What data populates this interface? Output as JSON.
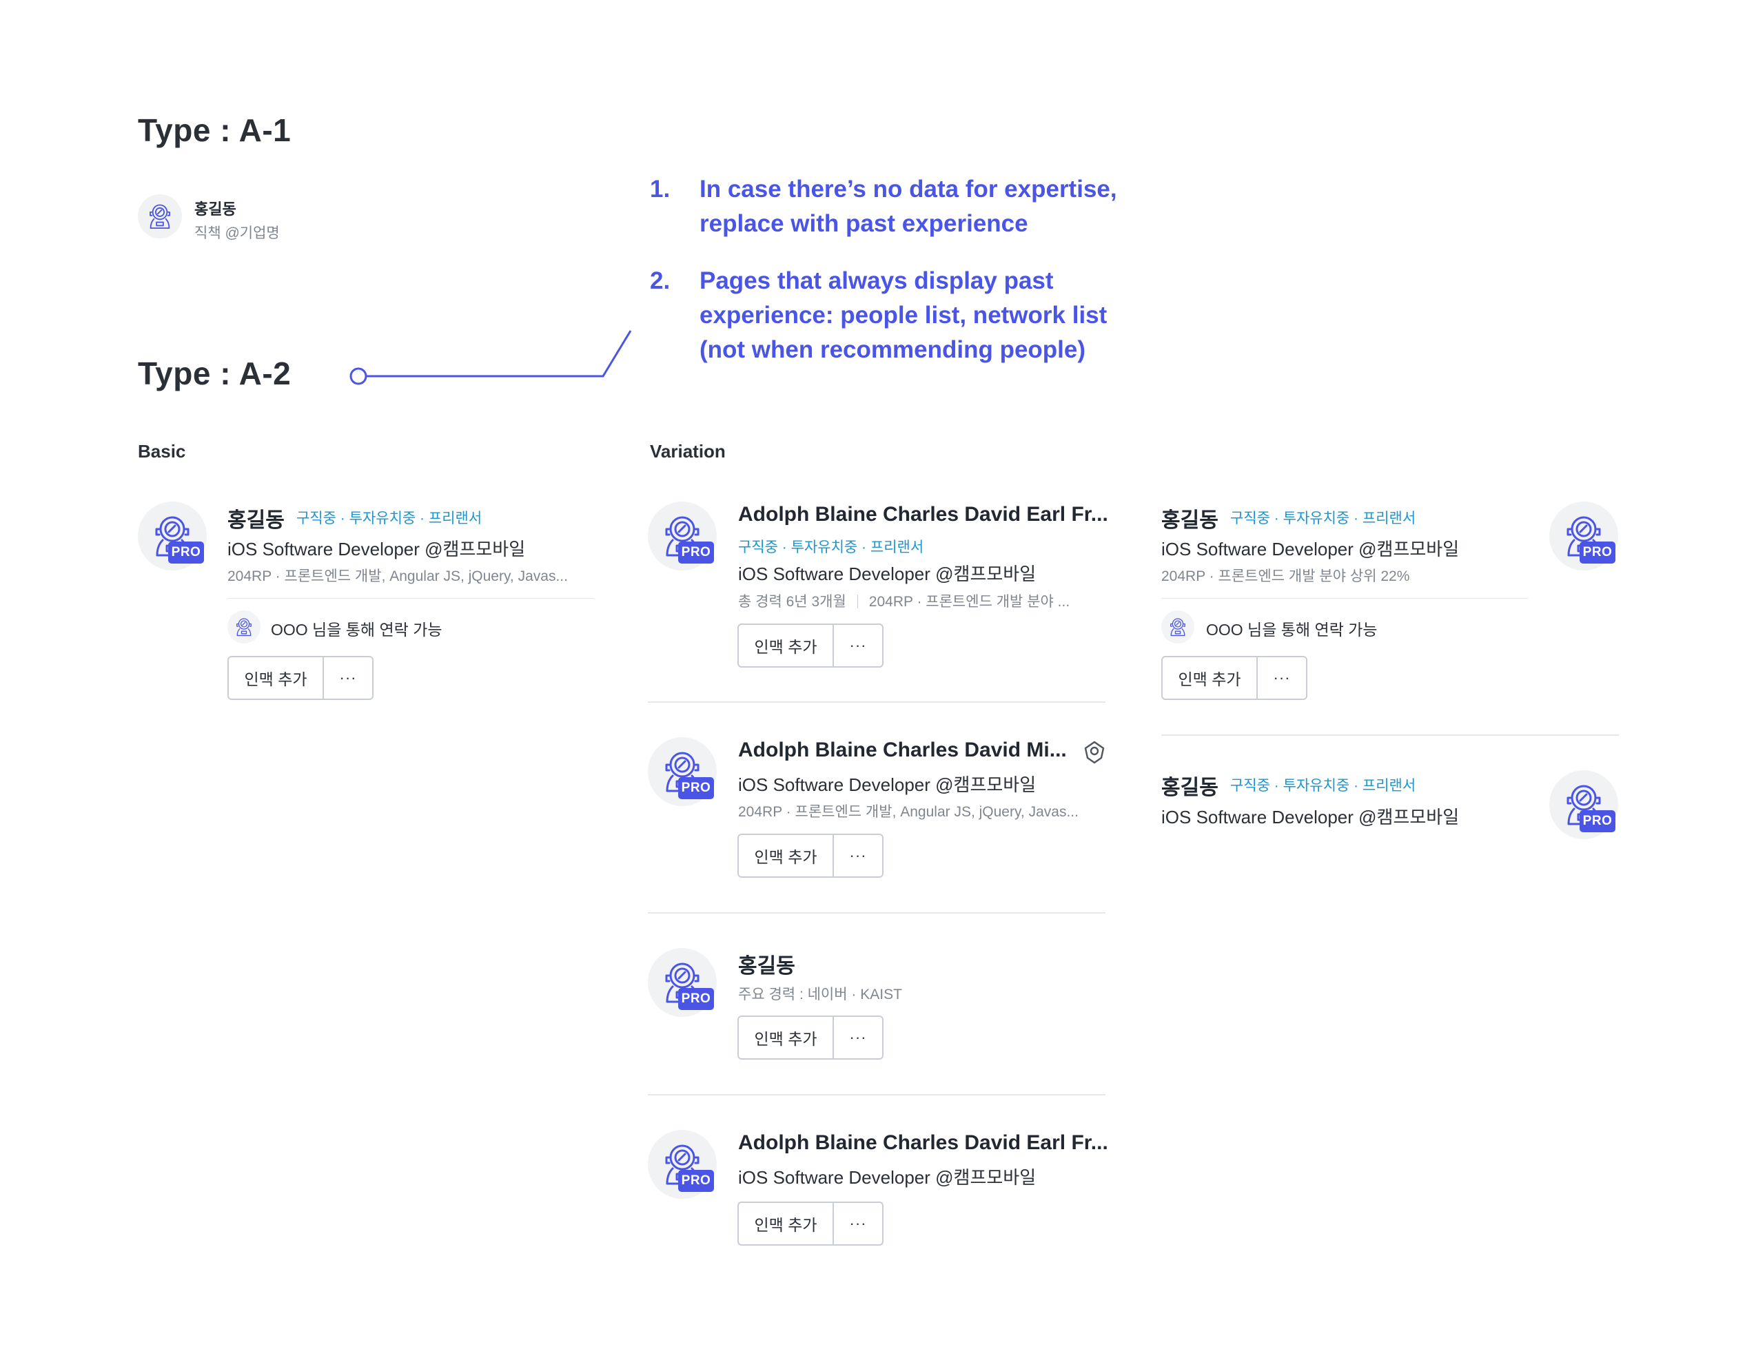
{
  "type_a1": {
    "title": "Type : A-1",
    "name": "홍길동",
    "subtitle": "직책 @기업명"
  },
  "type_a2": {
    "title": "Type : A-2"
  },
  "notes": [
    {
      "num": "1.",
      "text": "In case there’s no data for expertise, replace with past experience"
    },
    {
      "num": "2.",
      "text": "Pages that always display past experience: people list, network list (not when recommending people)"
    }
  ],
  "basic": {
    "label": "Basic",
    "card": {
      "name": "홍길동",
      "badges": "구직중 · 투자유치중 · 프리랜서",
      "role": "iOS Software Developer @캠프모바일",
      "meta": "204RP · 프론트엔드 개발, Angular JS, jQuery, Javas...",
      "contact": "OOO 님을 통해 연락 가능",
      "pro": "PRO",
      "add_button": "인맥 추가",
      "more_button": "···"
    }
  },
  "variation": {
    "label": "Variation",
    "cards": [
      {
        "name": "Adolph Blaine Charles David Earl Fr...",
        "badges": "구직중 · 투자유치중 · 프리랜서",
        "role": "iOS Software Developer @캠프모바일",
        "meta_a": "총 경력 6년 3개월",
        "meta_b": "204RP · 프론트엔드 개발 분야 ...",
        "pro": "PRO",
        "add_button": "인맥 추가",
        "more_button": "···"
      },
      {
        "name": "Adolph Blaine Charles David Mi...",
        "role": "iOS Software Developer @캠프모바일",
        "meta": "204RP · 프론트엔드 개발, Angular JS, jQuery, Javas...",
        "pro": "PRO",
        "add_button": "인맥 추가",
        "more_button": "···"
      },
      {
        "name": "홍길동",
        "meta": "주요 경력 : 네이버 · KAIST",
        "pro": "PRO",
        "add_button": "인맥 추가",
        "more_button": "···"
      },
      {
        "name": "Adolph Blaine Charles David Earl Fr...",
        "role": "iOS Software Developer @캠프모바일",
        "pro": "PRO",
        "add_button": "인맥 추가",
        "more_button": "···"
      }
    ],
    "right_cards": [
      {
        "name": "홍길동",
        "badges": "구직중 · 투자유치중 · 프리랜서",
        "role": "iOS Software Developer @캠프모바일",
        "meta": "204RP · 프론트엔드 개발 분야 상위 22%",
        "contact": "OOO 님을 통해 연락 가능",
        "pro": "PRO",
        "add_button": "인맥 추가",
        "more_button": "···"
      },
      {
        "name": "홍길동",
        "badges": "구직중 · 투자유치중 · 프리랜서",
        "role": "iOS Software Developer @캠프모바일",
        "pro": "PRO"
      }
    ]
  },
  "colors": {
    "accent": "#4a55e6",
    "badge_text": "#1a96d0",
    "pro_badge": "#4a55e6",
    "muted_text": "#80868f",
    "heading": "#2b2f36"
  },
  "icons": {
    "avatar": "astronaut-avatar-icon",
    "verified": "pin-verified-icon"
  }
}
